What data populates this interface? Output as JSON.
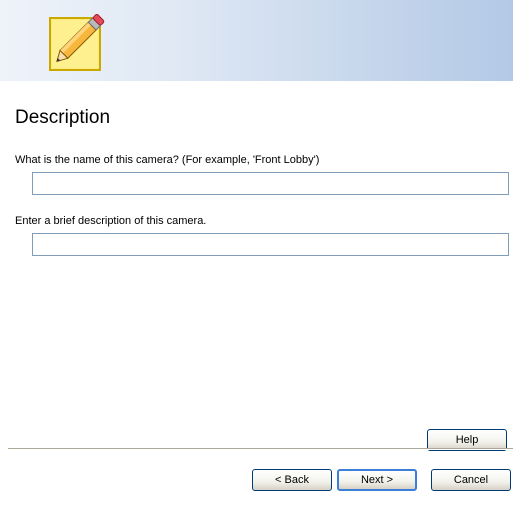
{
  "header": {
    "icon": "pencil-note-icon"
  },
  "page": {
    "title": "Description"
  },
  "form": {
    "name_label": "What is the name of this camera? (For example, 'Front Lobby')",
    "name_value": "",
    "description_label": "Enter a brief description of this camera.",
    "description_value": ""
  },
  "buttons": {
    "help": "Help",
    "back": "< Back",
    "next": "Next >",
    "cancel": "Cancel"
  },
  "colors": {
    "banner_start": "#eef3fa",
    "banner_end": "#b3c9e6",
    "input_border": "#7f9db9",
    "focus_border": "#3c7fd8"
  }
}
